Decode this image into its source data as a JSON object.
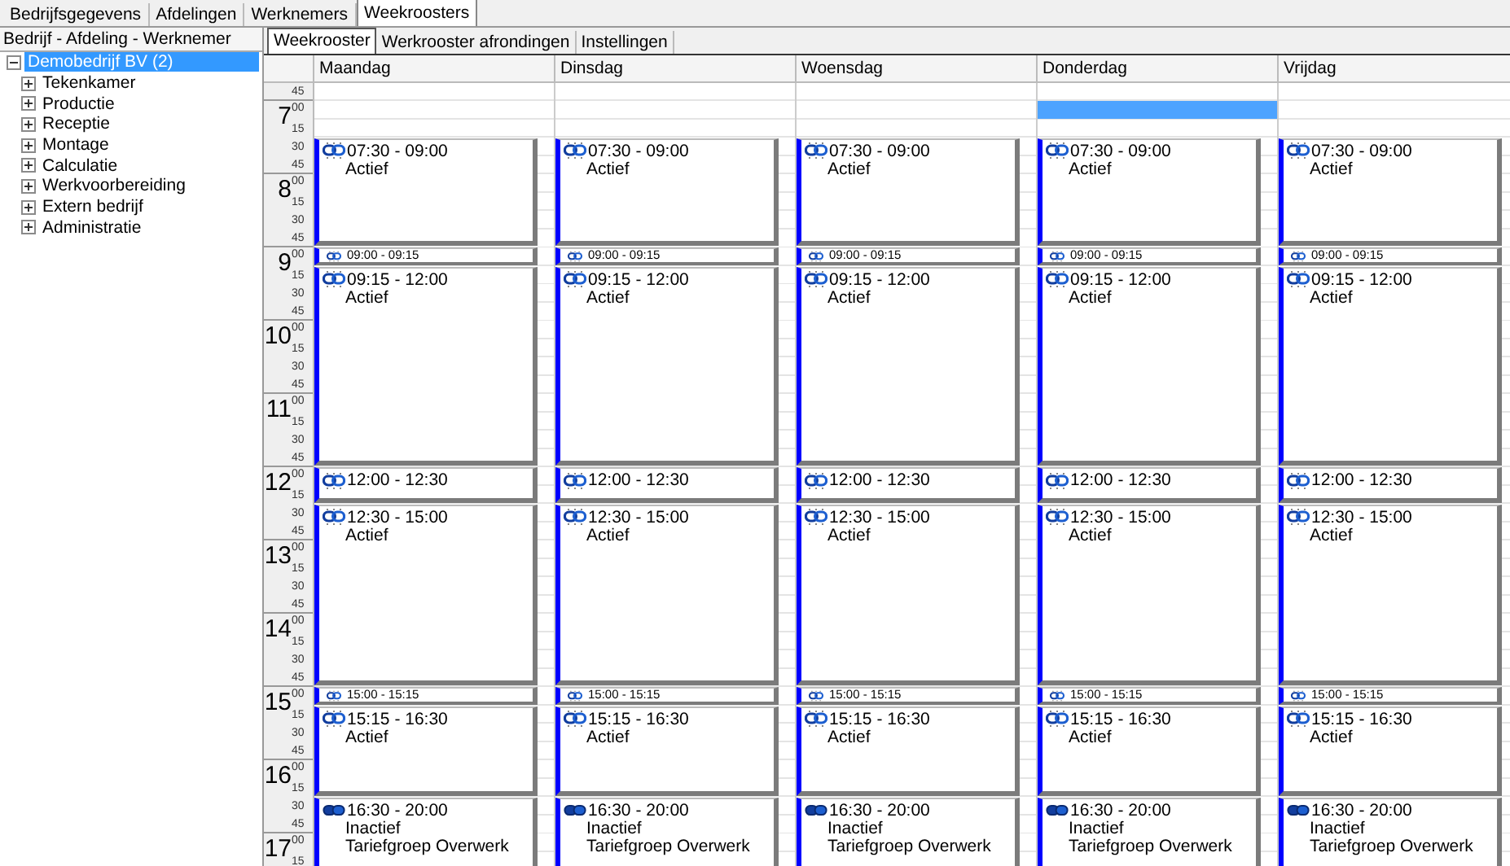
{
  "top_tabs": [
    {
      "label": "Bedrijfsgegevens",
      "selected": false
    },
    {
      "label": "Afdelingen",
      "selected": false
    },
    {
      "label": "Werknemers",
      "selected": false
    },
    {
      "label": "Weekroosters",
      "selected": true
    }
  ],
  "tree": {
    "header": "Bedrijf - Afdeling - Werknemer",
    "root": {
      "label": "Demobedrijf BV (2)",
      "selected": true,
      "expanded": true,
      "children": [
        {
          "label": "Tekenkamer",
          "expanded": false
        },
        {
          "label": "Productie",
          "expanded": false
        },
        {
          "label": "Receptie",
          "expanded": false
        },
        {
          "label": "Montage",
          "expanded": false
        },
        {
          "label": "Calculatie",
          "expanded": false
        },
        {
          "label": "Werkvoorbereiding",
          "expanded": false
        },
        {
          "label": "Extern bedrijf",
          "expanded": false
        },
        {
          "label": "Administratie",
          "expanded": false
        }
      ]
    }
  },
  "sub_tabs": [
    {
      "label": "Weekrooster",
      "selected": true
    },
    {
      "label": "Werkrooster afrondingen",
      "selected": false
    },
    {
      "label": "Instellingen",
      "selected": false
    }
  ],
  "time_axis": {
    "first_minute": "45",
    "hours": [
      {
        "hour": "7",
        "minutes": [
          "00",
          "15",
          "30",
          "45"
        ]
      },
      {
        "hour": "8",
        "minutes": [
          "00",
          "15",
          "30",
          "45"
        ]
      },
      {
        "hour": "9",
        "minutes": [
          "00",
          "15",
          "30",
          "45"
        ]
      },
      {
        "hour": "10",
        "minutes": [
          "00",
          "15",
          "30",
          "45"
        ]
      },
      {
        "hour": "11",
        "minutes": [
          "00",
          "15",
          "30",
          "45"
        ]
      },
      {
        "hour": "12",
        "minutes": [
          "00",
          "15",
          "30",
          "45"
        ]
      },
      {
        "hour": "13",
        "minutes": [
          "00",
          "15",
          "30",
          "45"
        ]
      },
      {
        "hour": "14",
        "minutes": [
          "00",
          "15",
          "30",
          "45"
        ]
      },
      {
        "hour": "15",
        "minutes": [
          "00",
          "15",
          "30",
          "45"
        ]
      },
      {
        "hour": "16",
        "minutes": [
          "00",
          "15",
          "30",
          "45"
        ]
      },
      {
        "hour": "17",
        "minutes": [
          "00",
          "15"
        ]
      }
    ]
  },
  "days": [
    {
      "name": "Maandag",
      "selected": false,
      "events": [
        {
          "time": "07:30 - 09:00",
          "active": true,
          "lines": [
            "Actief"
          ]
        },
        {
          "time": "09:00 - 09:15",
          "active": true
        },
        {
          "time": "09:15 - 12:00",
          "active": true,
          "lines": [
            "Actief"
          ]
        },
        {
          "time": "12:00 - 12:30",
          "active": true
        },
        {
          "time": "12:30 - 15:00",
          "active": true,
          "lines": [
            "Actief"
          ]
        },
        {
          "time": "15:00 - 15:15",
          "active": true
        },
        {
          "time": "15:15 - 16:30",
          "active": true,
          "lines": [
            "Actief"
          ]
        },
        {
          "time": "16:30 - 20:00",
          "active": false,
          "lines": [
            "Inactief",
            "Tariefgroep Overwerk"
          ]
        }
      ]
    },
    {
      "name": "Dinsdag",
      "selected": false,
      "events": [
        {
          "time": "07:30 - 09:00",
          "active": true,
          "lines": [
            "Actief"
          ]
        },
        {
          "time": "09:00 - 09:15",
          "active": true
        },
        {
          "time": "09:15 - 12:00",
          "active": true,
          "lines": [
            "Actief"
          ]
        },
        {
          "time": "12:00 - 12:30",
          "active": true
        },
        {
          "time": "12:30 - 15:00",
          "active": true,
          "lines": [
            "Actief"
          ]
        },
        {
          "time": "15:00 - 15:15",
          "active": true
        },
        {
          "time": "15:15 - 16:30",
          "active": true,
          "lines": [
            "Actief"
          ]
        },
        {
          "time": "16:30 - 20:00",
          "active": false,
          "lines": [
            "Inactief",
            "Tariefgroep Overwerk"
          ]
        }
      ]
    },
    {
      "name": "Woensdag",
      "selected": false,
      "events": [
        {
          "time": "07:30 - 09:00",
          "active": true,
          "lines": [
            "Actief"
          ]
        },
        {
          "time": "09:00 - 09:15",
          "active": true
        },
        {
          "time": "09:15 - 12:00",
          "active": true,
          "lines": [
            "Actief"
          ]
        },
        {
          "time": "12:00 - 12:30",
          "active": true
        },
        {
          "time": "12:30 - 15:00",
          "active": true,
          "lines": [
            "Actief"
          ]
        },
        {
          "time": "15:00 - 15:15",
          "active": true
        },
        {
          "time": "15:15 - 16:30",
          "active": true,
          "lines": [
            "Actief"
          ]
        },
        {
          "time": "16:30 - 20:00",
          "active": false,
          "lines": [
            "Inactief",
            "Tariefgroep Overwerk"
          ]
        }
      ]
    },
    {
      "name": "Donderdag",
      "selected": true,
      "events": [
        {
          "time": "07:30 - 09:00",
          "active": true,
          "lines": [
            "Actief"
          ]
        },
        {
          "time": "09:00 - 09:15",
          "active": true
        },
        {
          "time": "09:15 - 12:00",
          "active": true,
          "lines": [
            "Actief"
          ]
        },
        {
          "time": "12:00 - 12:30",
          "active": true
        },
        {
          "time": "12:30 - 15:00",
          "active": true,
          "lines": [
            "Actief"
          ]
        },
        {
          "time": "15:00 - 15:15",
          "active": true
        },
        {
          "time": "15:15 - 16:30",
          "active": true,
          "lines": [
            "Actief"
          ]
        },
        {
          "time": "16:30 - 20:00",
          "active": false,
          "lines": [
            "Inactief",
            "Tariefgroep Overwerk"
          ]
        }
      ]
    },
    {
      "name": "Vrijdag",
      "selected": false,
      "events": [
        {
          "time": "07:30 - 09:00",
          "active": true,
          "lines": [
            "Actief"
          ]
        },
        {
          "time": "09:00 - 09:15",
          "active": true
        },
        {
          "time": "09:15 - 12:00",
          "active": true,
          "lines": [
            "Actief"
          ]
        },
        {
          "time": "12:00 - 12:30",
          "active": true
        },
        {
          "time": "12:30 - 15:00",
          "active": true,
          "lines": [
            "Actief"
          ]
        },
        {
          "time": "15:00 - 15:15",
          "active": true
        },
        {
          "time": "15:15 - 16:30",
          "active": true,
          "lines": [
            "Actief"
          ]
        },
        {
          "time": "16:30 - 20:00",
          "active": false,
          "lines": [
            "Inactief",
            "Tariefgroep Overwerk"
          ]
        }
      ]
    }
  ]
}
